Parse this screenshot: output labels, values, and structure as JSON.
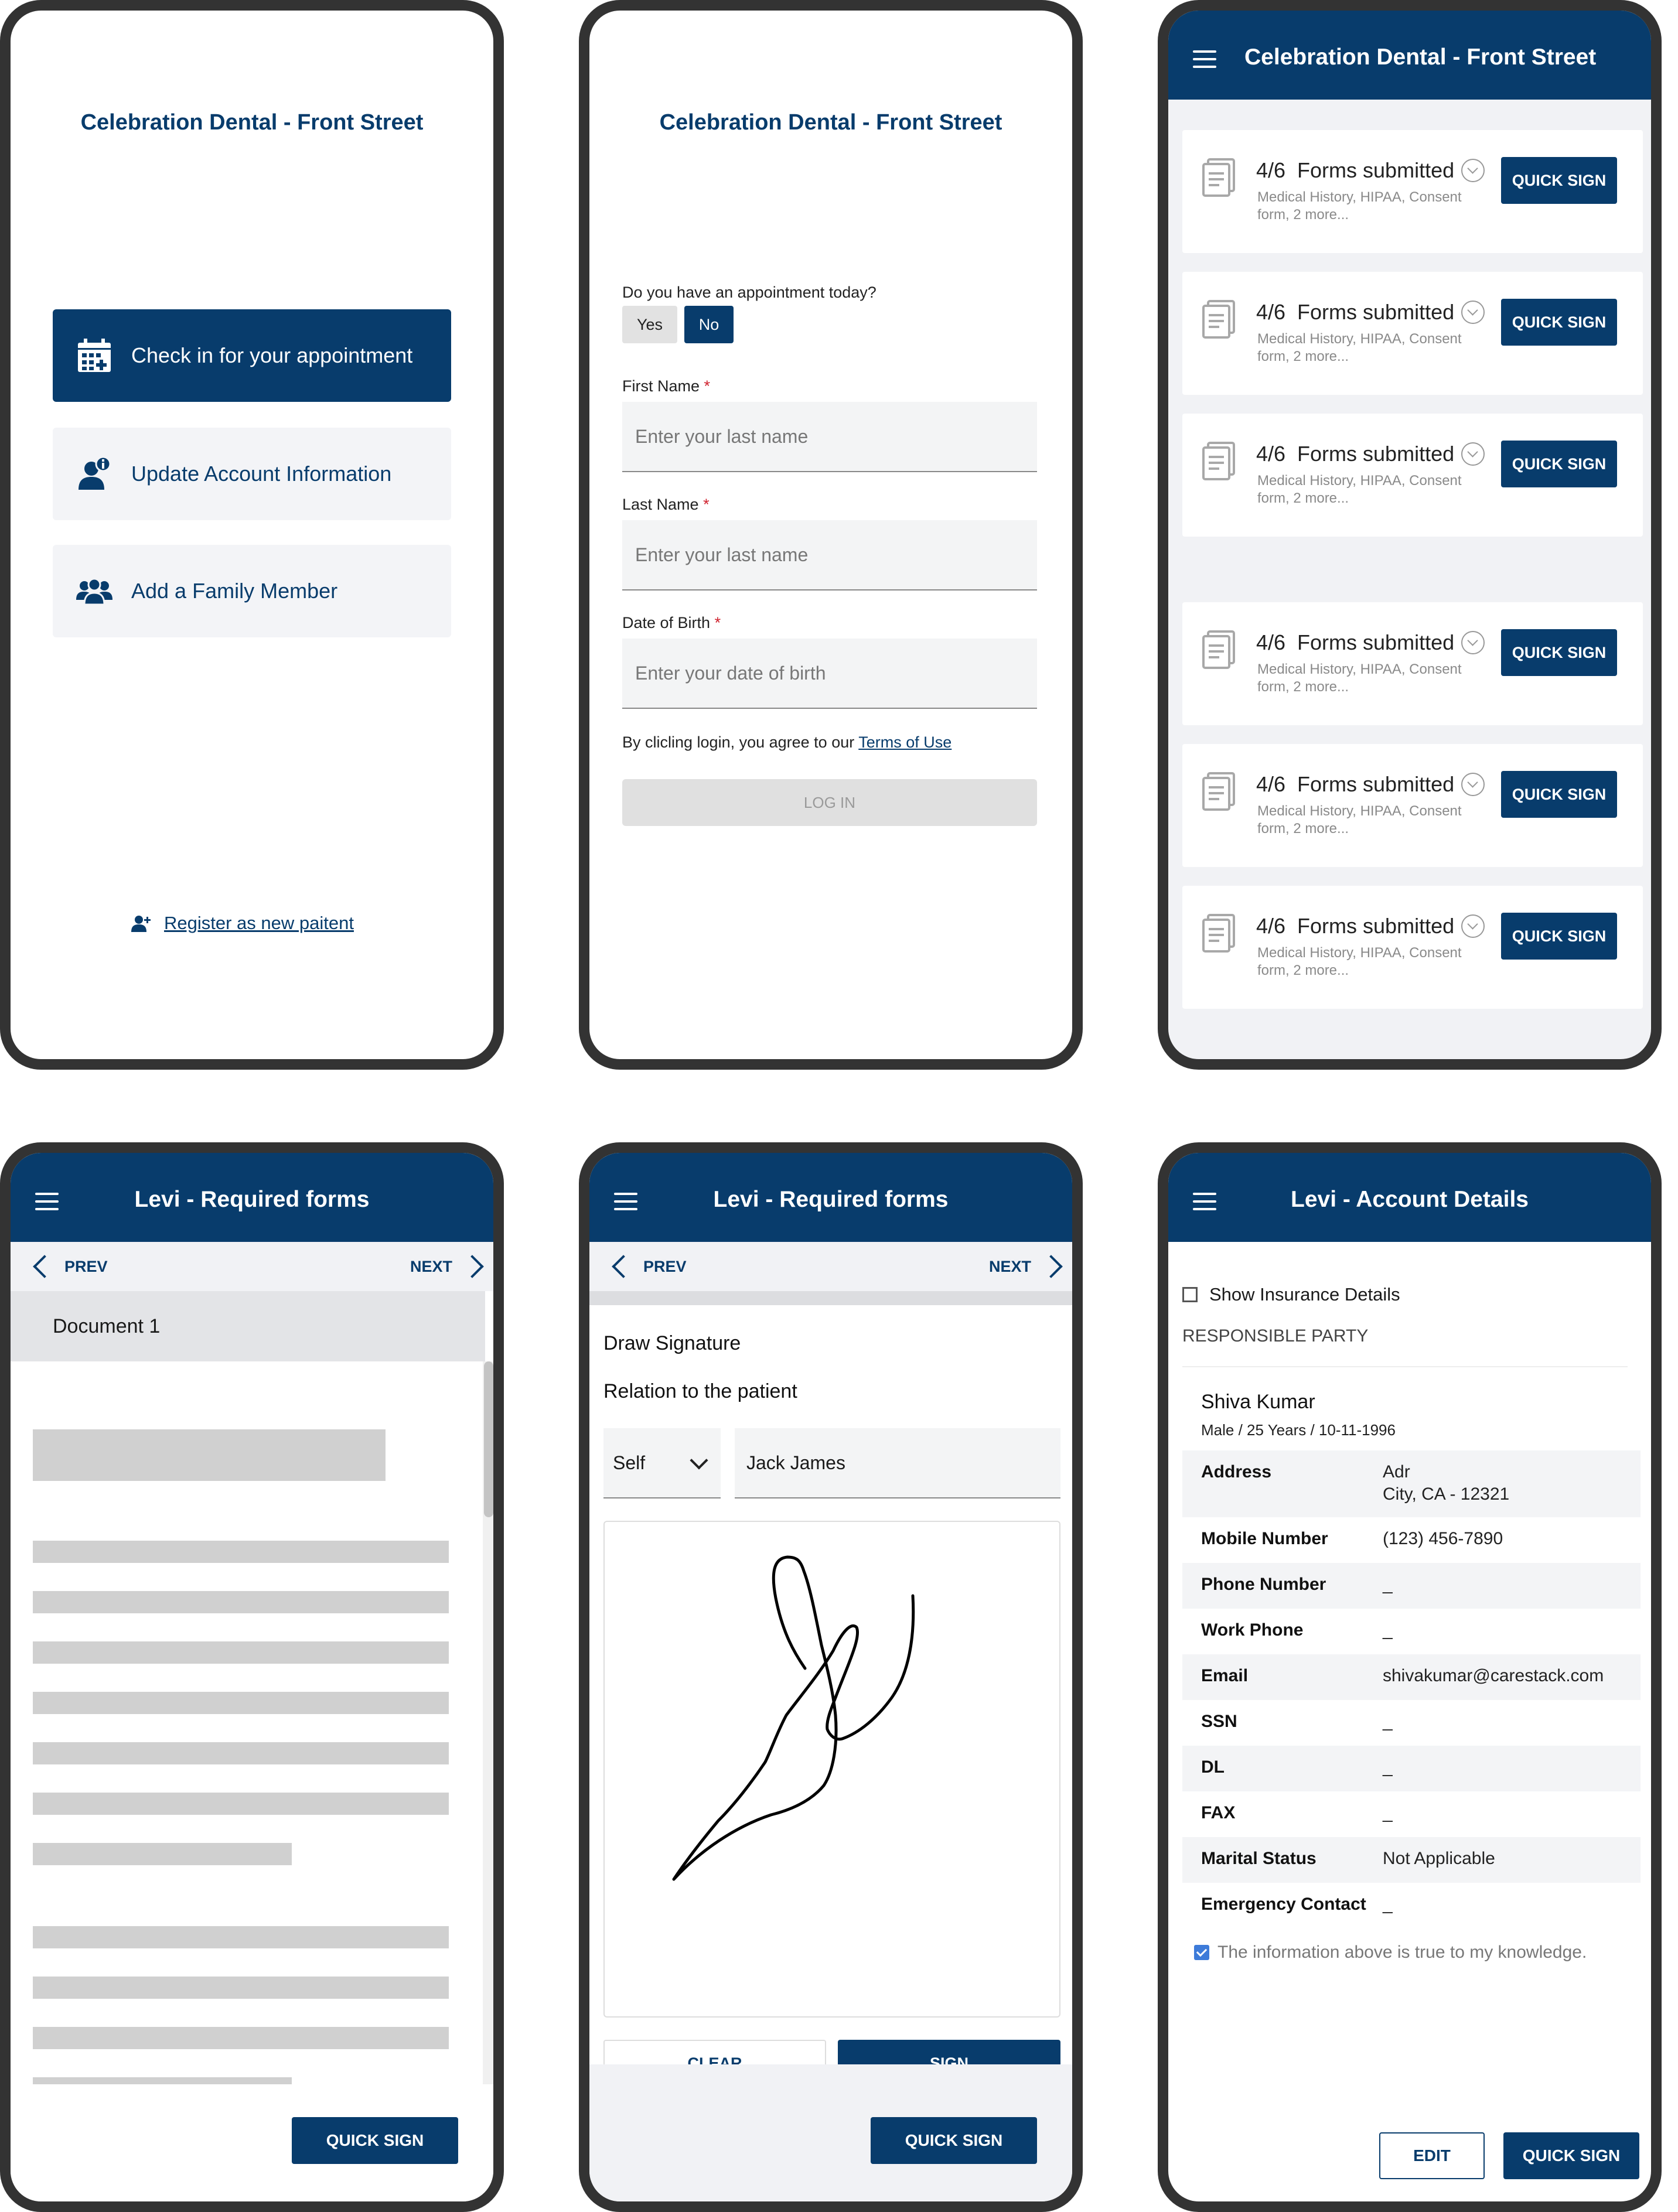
{
  "clinic_name": "Celebration Dental - Front Street",
  "home": {
    "check_in": "Check in for your appointment",
    "update_account": "Update Account Information",
    "add_family": "Add a Family Member",
    "register": "Register as new paitent",
    "icons": [
      "calendar-plus-icon",
      "user-info-icon",
      "family-icon",
      "user-plus-icon"
    ]
  },
  "login": {
    "appointment_question": "Do you have an appointment today?",
    "yes": "Yes",
    "no": "No",
    "selected": "No",
    "first_name_label": "First Name",
    "first_name_placeholder": "Enter your last name",
    "last_name_label": "Last Name",
    "last_name_placeholder": "Enter your last name",
    "dob_label": "Date of Birth",
    "dob_placeholder": "Enter your date of birth",
    "required_mark": "*",
    "terms_prefix": "By clicling login, you agree to our",
    "terms_link": "Terms of Use",
    "login_button": "LOG IN"
  },
  "forms_list": {
    "cards": [
      {
        "count": "4/6",
        "label": "Forms submitted",
        "sub": "Medical History, HIPAA, Consent form, 2 more...",
        "action": "QUICK SIGN"
      },
      {
        "count": "4/6",
        "label": "Forms submitted",
        "sub": "Medical History, HIPAA, Consent form, 2 more...",
        "action": "QUICK SIGN"
      },
      {
        "count": "4/6",
        "label": "Forms submitted",
        "sub": "Medical History, HIPAA, Consent form, 2 more...",
        "action": "QUICK SIGN"
      },
      {
        "count": "4/6",
        "label": "Forms submitted",
        "sub": "Medical History, HIPAA, Consent form, 2 more...",
        "action": "QUICK SIGN"
      },
      {
        "count": "4/6",
        "label": "Forms submitted",
        "sub": "Medical History, HIPAA, Consent form, 2 more...",
        "action": "QUICK SIGN"
      },
      {
        "count": "4/6",
        "label": "Forms submitted",
        "sub": "Medical History, HIPAA, Consent form, 2 more...",
        "action": "QUICK SIGN"
      }
    ]
  },
  "required_forms": {
    "title": "Levi - Required forms",
    "prev": "PREV",
    "next": "NEXT",
    "document_tab": "Document 1",
    "quick_sign": "QUICK SIGN"
  },
  "signature": {
    "title": "Levi - Required forms",
    "prev": "PREV",
    "next": "NEXT",
    "draw_signature": "Draw Signature",
    "relation_label": "Relation to the patient",
    "relation_value": "Self",
    "relation_name": "Jack James",
    "clear": "CLEAR",
    "sign": "SIGN",
    "quick_sign": "QUICK SIGN"
  },
  "account": {
    "title": "Levi - Account Details",
    "show_insurance": "Show Insurance Details",
    "responsible_party": "RESPONSIBLE PARTY",
    "name": "Shiva Kumar",
    "info": "Male / 25 Years / 10-11-1996",
    "rows": [
      {
        "key": "Address",
        "value": "Adr",
        "value2": "City, CA - 12321"
      },
      {
        "key": "Mobile Number",
        "value": "(123) 456-7890"
      },
      {
        "key": "Phone Number",
        "value": "_"
      },
      {
        "key": "Work Phone",
        "value": "_"
      },
      {
        "key": "Email",
        "value": "shivakumar@carestack.com"
      },
      {
        "key": "SSN",
        "value": "_"
      },
      {
        "key": "DL",
        "value": "_"
      },
      {
        "key": "FAX",
        "value": "_"
      },
      {
        "key": "Marital Status",
        "value": "Not Applicable"
      },
      {
        "key": "Emergency Contact",
        "value": "_"
      }
    ],
    "attestation": "The information above is true to my knowledge.",
    "edit": "EDIT",
    "quick_sign": "QUICK SIGN"
  },
  "colors": {
    "primary": "#083c6c",
    "required": "#d0232f",
    "checkbox": "#3d7bd9"
  }
}
